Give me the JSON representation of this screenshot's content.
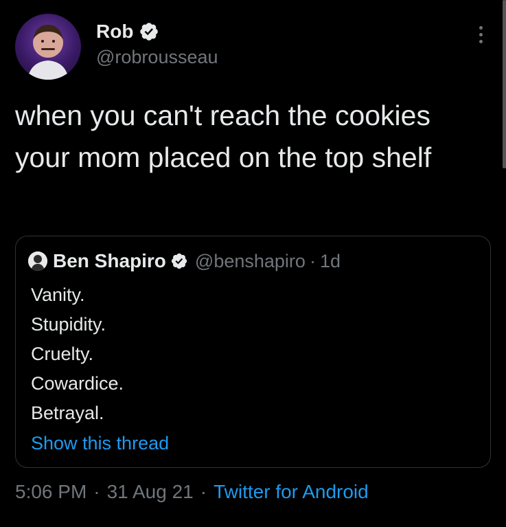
{
  "author": {
    "display_name": "Rob",
    "handle": "@robrousseau",
    "avatar_icon": "avatar-photo",
    "verified_icon": "verified-badge-icon"
  },
  "tweet": {
    "text": "when you can't reach the cookies your mom placed on the top shelf"
  },
  "quoted_tweet": {
    "display_name": "Ben Shapiro",
    "handle": "@benshapiro",
    "separator": "·",
    "time": "1d",
    "lines": [
      "Vanity.",
      "Stupidity.",
      "Cruelty.",
      "Cowardice.",
      "Betrayal."
    ],
    "show_thread": "Show this thread"
  },
  "meta": {
    "time": "5:06 PM",
    "date": "31 Aug 21",
    "source": "Twitter for Android",
    "separator": "·"
  },
  "colors": {
    "background": "#000000",
    "text": "#e7e9ea",
    "muted": "#71767b",
    "link": "#1d9bf0",
    "border": "#2f3336"
  }
}
